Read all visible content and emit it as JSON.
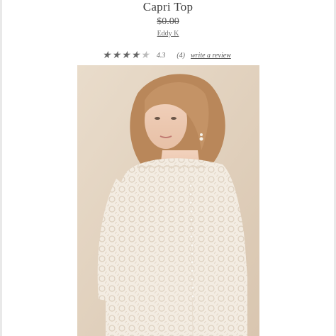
{
  "product": {
    "title": "Capri Top",
    "price": "$0.00",
    "brand": "Eddy K"
  },
  "rating": {
    "value": "4.3",
    "count": "(4)",
    "stars_filled": 4,
    "stars_total": 5,
    "write_review_label": "write a review"
  },
  "colors": {
    "background": "#ffffff",
    "photo_backdrop": "#e6d7c4",
    "lace": "#f3ece2",
    "hair": "#b9875a"
  },
  "image": {
    "subject": "model wearing lace top, back view"
  }
}
